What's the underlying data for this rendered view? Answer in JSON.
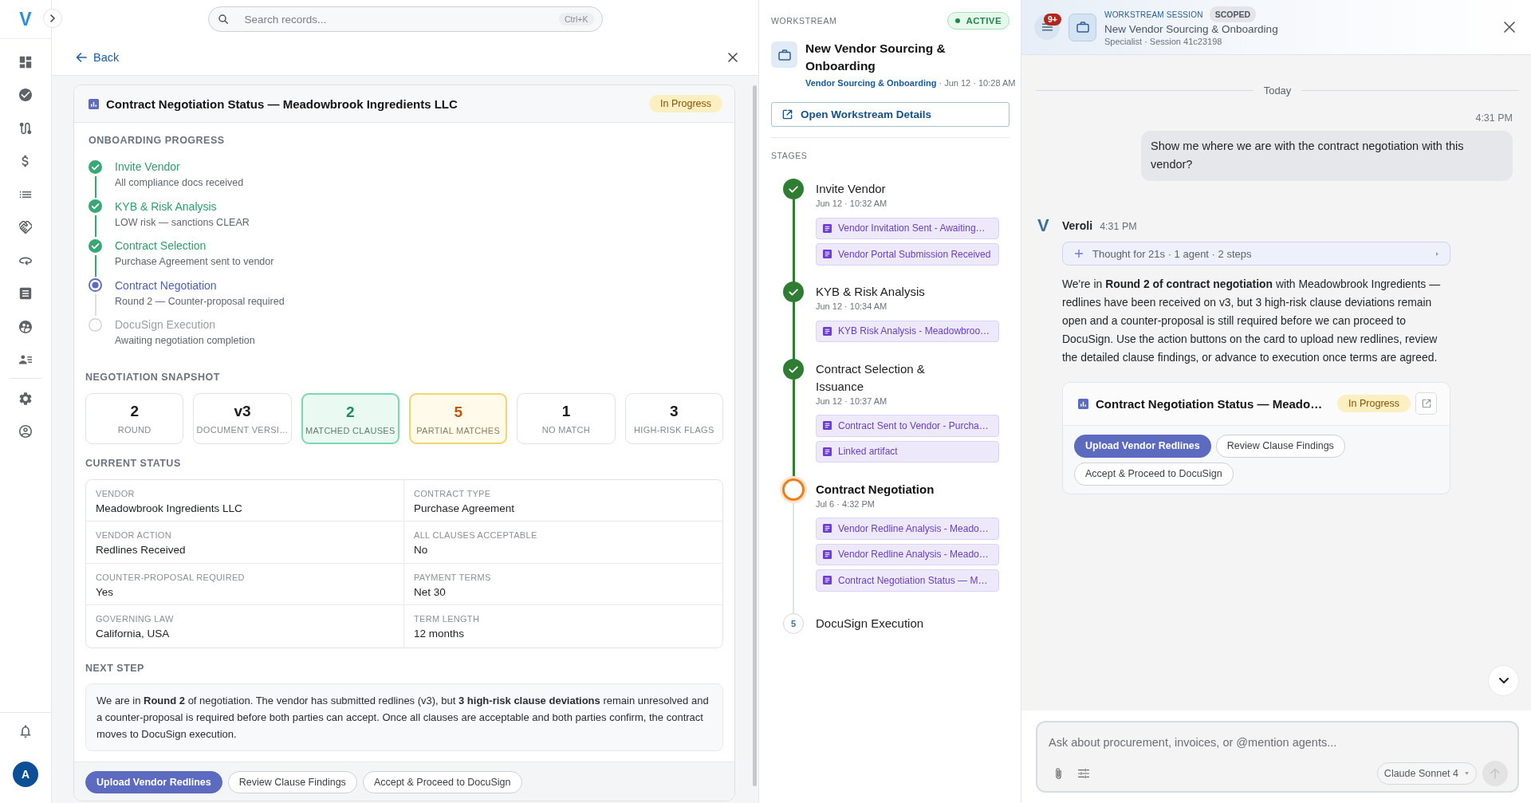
{
  "sidebar": {
    "logo": "V",
    "avatar": "A"
  },
  "search": {
    "placeholder": "Search records...",
    "shortcut": "Ctrl+K"
  },
  "detail": {
    "back": "Back",
    "card": {
      "title": "Contract Negotiation Status — Meadowbrook Ingredients LLC",
      "status": "In Progress",
      "onboarding": {
        "heading": "ONBOARDING PROGRESS",
        "steps": [
          {
            "title": "Invite Vendor",
            "note": "All compliance docs received",
            "done": true,
            "current": false
          },
          {
            "title": "KYB & Risk Analysis",
            "note": "LOW risk — sanctions CLEAR",
            "done": true,
            "current": false
          },
          {
            "title": "Contract Selection",
            "note": "Purchase Agreement sent to vendor",
            "done": true,
            "current": false
          },
          {
            "title": "Contract Negotiation",
            "note": "Round 2 — Counter-proposal required",
            "done": false,
            "current": true
          },
          {
            "title": "DocuSign Execution",
            "note": "Awaiting negotiation completion",
            "done": false,
            "current": false
          }
        ]
      },
      "snapshot": {
        "heading": "NEGOTIATION SNAPSHOT",
        "metrics": [
          {
            "value": "2",
            "label": "ROUND",
            "kind": "plain"
          },
          {
            "value": "v3",
            "label": "DOCUMENT VERSI…",
            "kind": "plain"
          },
          {
            "value": "2",
            "label": "MATCHED CLAUSES",
            "kind": "matched"
          },
          {
            "value": "5",
            "label": "PARTIAL MATCHES",
            "kind": "partial"
          },
          {
            "value": "1",
            "label": "NO MATCH",
            "kind": "plain"
          },
          {
            "value": "3",
            "label": "HIGH-RISK FLAGS",
            "kind": "plain"
          }
        ]
      },
      "current_status": {
        "heading": "CURRENT STATUS",
        "fields": [
          {
            "label": "VENDOR",
            "value": "Meadowbrook Ingredients LLC"
          },
          {
            "label": "CONTRACT TYPE",
            "value": "Purchase Agreement"
          },
          {
            "label": "VENDOR ACTION",
            "value": "Redlines Received"
          },
          {
            "label": "ALL CLAUSES ACCEPTABLE",
            "value": "No"
          },
          {
            "label": "COUNTER-PROPOSAL REQUIRED",
            "value": "Yes"
          },
          {
            "label": "PAYMENT TERMS",
            "value": "Net 30"
          },
          {
            "label": "GOVERNING LAW",
            "value": "California, USA"
          },
          {
            "label": "TERM LENGTH",
            "value": "12 months"
          }
        ]
      },
      "next_step": {
        "heading": "NEXT STEP",
        "text": "We are in **Round 2** of negotiation. The vendor has submitted redlines (v3), but **3 high-risk clause deviations** remain unresolved and a counter-proposal is required before both parties can accept. Once all clauses are acceptable and both parties confirm, the contract moves to DocuSign execution."
      },
      "actions": [
        {
          "label": "Upload Vendor Redlines",
          "primary": true
        },
        {
          "label": "Review Clause Findings",
          "primary": false
        },
        {
          "label": "Accept & Proceed to DocuSign",
          "primary": false
        }
      ]
    }
  },
  "workstream": {
    "heading": "WORKSTREAM",
    "status": "ACTIVE",
    "title": "New Vendor Sourcing & Onboarding",
    "category": "Vendor Sourcing & Onboarding",
    "timestamp": "· Jun 12 · 10:28 AM",
    "open_details": "Open Workstream Details",
    "stages_heading": "STAGES",
    "stages": [
      {
        "title": "Invite Vendor",
        "time": "Jun 12 · 10:32 AM",
        "done": true,
        "current": false,
        "artifacts": [
          "Vendor Invitation Sent - Awaiting…",
          "Vendor Portal Submission Received"
        ]
      },
      {
        "title": "KYB & Risk Analysis",
        "time": "Jun 12 · 10:34 AM",
        "done": true,
        "current": false,
        "artifacts": [
          "KYB Risk Analysis - Meadowbroo…"
        ]
      },
      {
        "title": "Contract Selection & Issuance",
        "time": "Jun 12 · 10:37 AM",
        "done": true,
        "current": false,
        "artifacts": [
          "Contract Sent to Vendor - Purcha…",
          "Linked artifact"
        ]
      },
      {
        "title": "Contract Negotiation",
        "time": "Jul 6 · 4:32 PM",
        "done": false,
        "current": true,
        "artifacts": [
          "Vendor Redline Analysis - Meado…",
          "Vendor Redline Analysis - Meado…",
          "Contract Negotiation Status — M…"
        ]
      },
      {
        "title": "DocuSign Execution",
        "done": false,
        "current": false,
        "number": "5"
      }
    ]
  },
  "chat": {
    "header": {
      "badge": "9+",
      "label": "WORKSTREAM SESSION",
      "scope": "SCOPED",
      "title": "New Vendor Sourcing & Onboarding",
      "subtitle": "Specialist · Session 41c23198"
    },
    "day": "Today",
    "messages": [
      {
        "kind": "user",
        "time": "4:31 PM",
        "text": "Show me where we are with the contract negotiation with this vendor?"
      },
      {
        "kind": "assistant",
        "avatar": "V",
        "author": "Veroli",
        "time": "4:31 PM",
        "thought": "Thought for 21s · 1 agent · 2 steps",
        "text": "We're in **Round 2 of contract negotiation** with Meadowbrook Ingredients — redlines have been received on v3, but 3 high-risk clause deviations remain open and a counter-proposal is still required before we can proceed to DocuSign. Use the action buttons on the card to upload new redlines, review the detailed clause findings, or advance to execution once terms are agreed.",
        "card": {
          "title": "Contract Negotiation Status — Meado…",
          "status": "In Progress",
          "actions": [
            {
              "label": "Upload Vendor Redlines",
              "primary": true
            },
            {
              "label": "Review Clause Findings",
              "primary": false
            },
            {
              "label": "Accept & Proceed to DocuSign",
              "primary": false
            }
          ]
        }
      }
    ],
    "composer": {
      "placeholder": "Ask about procurement, invoices, or @mention agents...",
      "model": "Claude Sonnet 4",
      "send_disabled": true
    }
  }
}
